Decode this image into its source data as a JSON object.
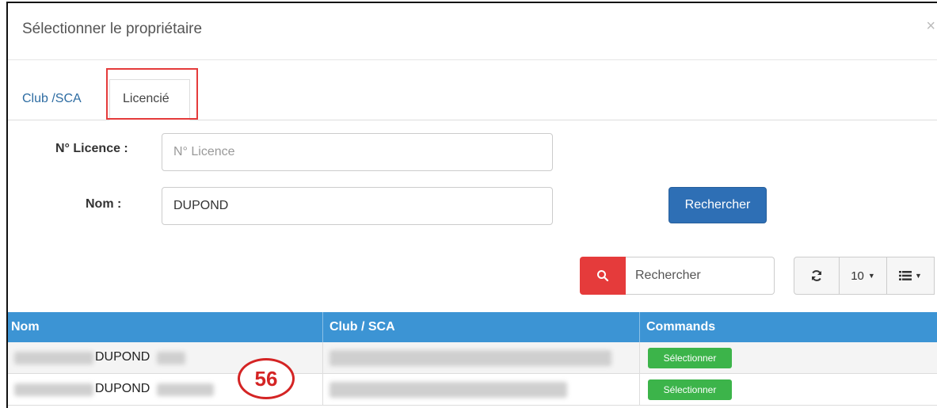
{
  "modal": {
    "title": "Sélectionner le propriétaire",
    "close": "×"
  },
  "tabs": [
    {
      "label": "Club /SCA"
    },
    {
      "label": "Licencié"
    }
  ],
  "form": {
    "licence_label": "N° Licence :",
    "licence_placeholder": "N° Licence",
    "licence_value": "",
    "nom_label": "Nom :",
    "nom_value": "DUPOND",
    "search_button": "Rechercher"
  },
  "toolbar": {
    "search_placeholder": "Rechercher",
    "page_size": "10",
    "colors": {
      "search_button": "#e53b3b",
      "primary": "#2e6fb5"
    }
  },
  "table": {
    "columns": [
      "Nom",
      "Club / SCA",
      "Commands"
    ],
    "rows": [
      {
        "nom": "DUPOND",
        "action": "Sélectionner"
      },
      {
        "nom": "DUPOND",
        "action": "Sélectionner"
      }
    ],
    "header_color": "#3c94d4",
    "action_color": "#3cb44a"
  },
  "badge": {
    "label": "56"
  }
}
